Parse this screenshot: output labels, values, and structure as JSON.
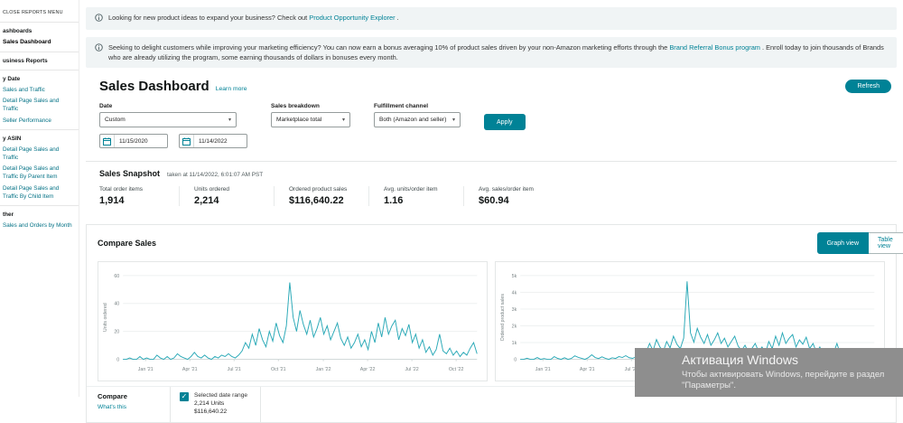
{
  "icons": {
    "chevron_down": "▾",
    "check": "✓"
  },
  "sidebar": {
    "items": [
      {
        "label": "CLOSE REPORTS MENU",
        "style": "header",
        "divider": false
      },
      {
        "label": "ashboards",
        "style": "section",
        "divider": true
      },
      {
        "label": "Sales Dashboard",
        "style": "current",
        "divider": false
      },
      {
        "label": "usiness Reports",
        "style": "section",
        "divider": true
      },
      {
        "label": "y Date",
        "style": "section",
        "divider": true
      },
      {
        "label": "Sales and Traffic",
        "style": "link",
        "divider": false
      },
      {
        "label": "Detail Page Sales and Traffic",
        "style": "link",
        "divider": false
      },
      {
        "label": "Seller Performance",
        "style": "link",
        "divider": false
      },
      {
        "label": "y ASIN",
        "style": "section",
        "divider": true
      },
      {
        "label": "Detail Page Sales and Traffic",
        "style": "link",
        "divider": false
      },
      {
        "label": "Detail Page Sales and Traffic By Parent Item",
        "style": "link",
        "divider": false
      },
      {
        "label": "Detail Page Sales and Traffic By Child Item",
        "style": "link",
        "divider": false
      },
      {
        "label": "ther",
        "style": "section",
        "divider": true
      },
      {
        "label": "Sales and Orders by Month",
        "style": "link",
        "divider": false
      }
    ]
  },
  "banners": [
    {
      "before": "Looking for new product ideas to expand your business? Check out ",
      "link": "Product Opportunity Explorer",
      "after": " ."
    },
    {
      "before": "Seeking to delight customers while improving your marketing efficiency? You can now earn a bonus averaging 10% of product sales driven by your non-Amazon marketing efforts through the ",
      "link": "Brand Referral Bonus program",
      "after": " . Enroll today to join thousands of Brands who are already utilizing the program, some earning thousands of dollars in bonuses every month."
    }
  ],
  "header": {
    "title": "Sales Dashboard",
    "learn_more": "Learn more",
    "refresh_label": "Refresh"
  },
  "filters": {
    "date_label": "Date",
    "date_value": "Custom",
    "date_from": "11/15/2020",
    "date_to": "11/14/2022",
    "breakdown_label": "Sales breakdown",
    "breakdown_value": "Marketplace total",
    "channel_label": "Fulfillment channel",
    "channel_value": "Both (Amazon and seller)",
    "apply_label": "Apply"
  },
  "snapshot": {
    "title": "Sales Snapshot",
    "taken": "taken at 11/14/2022, 6:01:07 AM PST",
    "stats": [
      {
        "label": "Total order items",
        "value": "1,914"
      },
      {
        "label": "Units ordered",
        "value": "2,214"
      },
      {
        "label": "Ordered product sales",
        "value": "$116,640.22"
      },
      {
        "label": "Avg. units/order item",
        "value": "1.16"
      },
      {
        "label": "Avg. sales/order item",
        "value": "$60.94"
      }
    ]
  },
  "compare": {
    "title": "Compare Sales",
    "graph_view": "Graph view",
    "table_view": "Table view",
    "footer_label": "Compare",
    "whats_this": "What's this",
    "legend": {
      "title": "Selected date range",
      "units": "2,214 Units",
      "sales": "$116,640.22"
    }
  },
  "chart_data": [
    {
      "type": "line",
      "ylabel": "Units ordered",
      "ylim": [
        0,
        60
      ],
      "yticks": [
        [
          0,
          "0"
        ],
        [
          20,
          "20"
        ],
        [
          40,
          "40"
        ],
        [
          60,
          "60"
        ]
      ],
      "xticks": [
        [
          0.064,
          "Jan '21"
        ],
        [
          0.189,
          "Apr '21"
        ],
        [
          0.314,
          "Jul '21"
        ],
        [
          0.439,
          "Oct '21"
        ],
        [
          0.566,
          "Jan '22"
        ],
        [
          0.691,
          "Apr '22"
        ],
        [
          0.816,
          "Jul '22"
        ],
        [
          0.941,
          "Oct '22"
        ]
      ],
      "color": "#2aa9b7",
      "values": [
        0,
        0,
        1,
        0,
        0,
        2,
        0,
        1,
        0,
        0,
        3,
        1,
        0,
        2,
        0,
        1,
        4,
        2,
        1,
        0,
        2,
        5,
        2,
        1,
        3,
        1,
        0,
        2,
        1,
        3,
        2,
        4,
        2,
        1,
        3,
        6,
        12,
        8,
        18,
        10,
        22,
        14,
        9,
        20,
        13,
        26,
        17,
        12,
        24,
        55,
        30,
        20,
        35,
        25,
        18,
        28,
        16,
        22,
        30,
        18,
        24,
        14,
        20,
        26,
        15,
        10,
        16,
        8,
        12,
        18,
        9,
        14,
        7,
        20,
        12,
        26,
        16,
        30,
        18,
        24,
        28,
        14,
        22,
        17,
        25,
        12,
        18,
        8,
        14,
        5,
        9,
        3,
        7,
        18,
        6,
        4,
        8,
        3,
        6,
        2,
        5,
        3,
        8,
        12,
        4
      ]
    },
    {
      "type": "line",
      "ylabel": "Ordered product sales",
      "ylim": [
        0,
        5000
      ],
      "yticks": [
        [
          0,
          "0"
        ],
        [
          1000,
          "1k"
        ],
        [
          2000,
          "2k"
        ],
        [
          3000,
          "3k"
        ],
        [
          4000,
          "4k"
        ],
        [
          5000,
          "5k"
        ]
      ],
      "xticks": [
        [
          0.064,
          "Jan '21"
        ],
        [
          0.189,
          "Apr '21"
        ],
        [
          0.314,
          "Jul '21"
        ],
        [
          0.439,
          "Oct '21"
        ],
        [
          0.566,
          "Jan '22"
        ],
        [
          0.691,
          "Apr '22"
        ],
        [
          0.816,
          "Jul '22"
        ],
        [
          0.941,
          "Oct '22"
        ]
      ],
      "color": "#2aa9b7",
      "values": [
        0,
        0,
        60,
        0,
        0,
        110,
        0,
        45,
        0,
        0,
        160,
        55,
        0,
        95,
        0,
        50,
        210,
        120,
        60,
        0,
        100,
        270,
        110,
        48,
        150,
        60,
        0,
        95,
        50,
        160,
        110,
        220,
        100,
        55,
        150,
        320,
        640,
        420,
        950,
        510,
        1180,
        740,
        470,
        1060,
        680,
        1380,
        900,
        640,
        1260,
        4650,
        1580,
        1020,
        1850,
        1320,
        950,
        1480,
        840,
        1160,
        1580,
        950,
        1260,
        740,
        1060,
        1380,
        790,
        530,
        840,
        420,
        640,
        950,
        470,
        740,
        370,
        1060,
        640,
        1380,
        840,
        1580,
        950,
        1260,
        1480,
        740,
        1160,
        900,
        1320,
        640,
        950,
        420,
        740,
        270,
        470,
        160,
        370,
        950,
        320,
        210,
        420,
        160,
        320,
        110,
        270,
        160,
        420,
        640,
        210
      ]
    }
  ],
  "watermark": {
    "line1": "Активация Windows",
    "line2": "Чтобы активировать Windows, перейдите в раздел",
    "line3": "\"Параметры\"."
  }
}
